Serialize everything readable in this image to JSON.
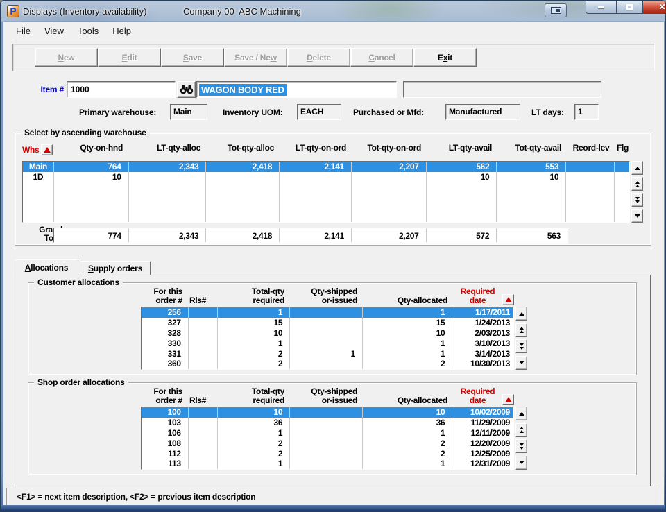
{
  "window": {
    "logo_letter": "P",
    "title": "Displays (Inventory availability)",
    "company": "Company 00  ABC Machining"
  },
  "menu": {
    "items": [
      "File",
      "View",
      "Tools",
      "Help"
    ]
  },
  "toolbar": {
    "buttons": [
      {
        "pre": "",
        "key": "N",
        "post": "ew",
        "enabled": false
      },
      {
        "pre": "",
        "key": "E",
        "post": "dit",
        "enabled": false
      },
      {
        "pre": "",
        "key": "S",
        "post": "ave",
        "enabled": false
      },
      {
        "pre": "Save / Ne",
        "key": "w",
        "post": "",
        "enabled": false
      },
      {
        "pre": "",
        "key": "D",
        "post": "elete",
        "enabled": false
      },
      {
        "pre": "",
        "key": "C",
        "post": "ancel",
        "enabled": false
      },
      {
        "pre": "E",
        "key": "x",
        "post": "it",
        "enabled": true
      }
    ]
  },
  "item": {
    "label": "Item #",
    "number": "1000",
    "description": "WAGON BODY RED"
  },
  "info_fields": [
    {
      "label": "Primary warehouse:",
      "value": "Main"
    },
    {
      "label": "Inventory UOM:",
      "value": "EACH"
    },
    {
      "label": "Purchased or Mfd:",
      "value": "Manufactured"
    },
    {
      "label": "LT days:",
      "value": "1"
    }
  ],
  "wh": {
    "group_title": "Select by ascending warehouse",
    "columns": [
      "Whs",
      "Qty-on-hnd",
      "LT-qty-alloc",
      "Tot-qty-alloc",
      "LT-qty-on-ord",
      "Tot-qty-on-ord",
      "LT-qty-avail",
      "Tot-qty-avail",
      "Reord-lev",
      "Flg"
    ],
    "rows": [
      [
        "Main",
        "764",
        "2,343",
        "2,418",
        "2,141",
        "2,207",
        "562",
        "553",
        "",
        ""
      ],
      [
        "1D",
        "10",
        "",
        "",
        "",
        "",
        "10",
        "10",
        "",
        ""
      ]
    ],
    "grand": {
      "label_line1": "Grand",
      "label_line2": "Total",
      "totals": [
        "774",
        "2,343",
        "2,418",
        "2,141",
        "2,207",
        "572",
        "563"
      ]
    }
  },
  "tabs": [
    {
      "pre": "",
      "key": "A",
      "post": "llocations"
    },
    {
      "pre": "",
      "key": "S",
      "post": "upply orders"
    }
  ],
  "hdr": {
    "c1a": "For this",
    "c1b": "order #",
    "c2": "Rls#",
    "c3a": "Total-qty",
    "c3b": "required",
    "c4a": "Qty-shipped",
    "c4b": "or-issued",
    "c5": "Qty-allocated",
    "c6a": "Required",
    "c6b": "date"
  },
  "cust": {
    "group_title": "Customer allocations",
    "rows": [
      [
        "256",
        "",
        "1",
        "",
        "1",
        "1/17/2011"
      ],
      [
        "327",
        "",
        "15",
        "",
        "15",
        "1/24/2013"
      ],
      [
        "328",
        "",
        "10",
        "",
        "10",
        "2/03/2013"
      ],
      [
        "330",
        "",
        "1",
        "",
        "1",
        "3/10/2013"
      ],
      [
        "331",
        "",
        "2",
        "1",
        "1",
        "3/14/2013"
      ],
      [
        "360",
        "",
        "2",
        "",
        "2",
        "10/30/2013"
      ]
    ]
  },
  "shop": {
    "group_title": "Shop order allocations",
    "rows": [
      [
        "100",
        "",
        "10",
        "",
        "10",
        "10/02/2009"
      ],
      [
        "103",
        "",
        "36",
        "",
        "36",
        "11/29/2009"
      ],
      [
        "106",
        "",
        "1",
        "",
        "1",
        "12/11/2009"
      ],
      [
        "108",
        "",
        "2",
        "",
        "2",
        "12/20/2009"
      ],
      [
        "112",
        "",
        "2",
        "",
        "2",
        "12/25/2009"
      ],
      [
        "113",
        "",
        "1",
        "",
        "1",
        "12/31/2009"
      ]
    ]
  },
  "status_bar": {
    "text": "<F1> = next item description, <F2> = previous item description"
  },
  "colors": {
    "selection": "#2E90E0",
    "header_red": "#D40000",
    "titlebar": "#ABBFD6",
    "frame": "#7E99BB"
  }
}
